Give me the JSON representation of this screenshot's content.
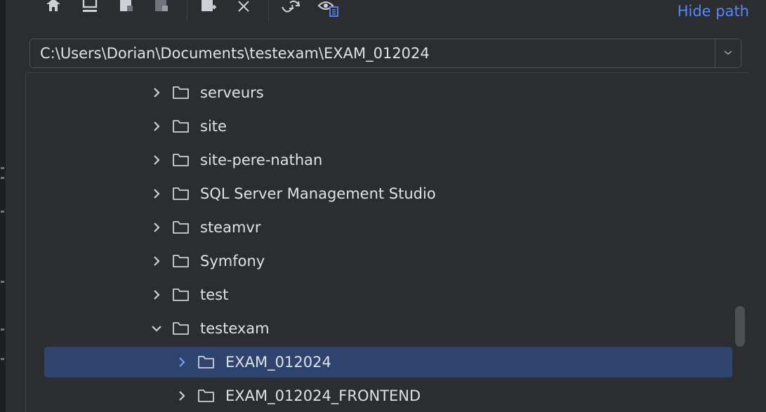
{
  "toolbar": {
    "icons": [
      "home-icon",
      "desktop-icon",
      "project-folder-icon",
      "module-folder-icon",
      "new-folder-icon",
      "delete-icon",
      "refresh-icon",
      "show-hidden-icon"
    ]
  },
  "hide_path_label": "Hide path",
  "path": {
    "value": "C:\\Users\\Dorian\\Documents\\testexam\\EXAM_012024"
  },
  "tree": {
    "items": [
      {
        "label": "serveurs",
        "expanded": false,
        "level": 0
      },
      {
        "label": "site",
        "expanded": false,
        "level": 0
      },
      {
        "label": "site-pere-nathan",
        "expanded": false,
        "level": 0
      },
      {
        "label": "SQL Server Management Studio",
        "expanded": false,
        "level": 0
      },
      {
        "label": "steamvr",
        "expanded": false,
        "level": 0
      },
      {
        "label": "Symfony",
        "expanded": false,
        "level": 0
      },
      {
        "label": "test",
        "expanded": false,
        "level": 0
      },
      {
        "label": "testexam",
        "expanded": true,
        "level": 0
      },
      {
        "label": "EXAM_012024",
        "expanded": false,
        "level": 1,
        "selected": true
      },
      {
        "label": "EXAM_012024_FRONTEND",
        "expanded": false,
        "level": 1
      }
    ]
  },
  "colors": {
    "background": "#2b2d30",
    "selection": "#2e436e",
    "link": "#548af7",
    "text": "#dfe1e5"
  }
}
